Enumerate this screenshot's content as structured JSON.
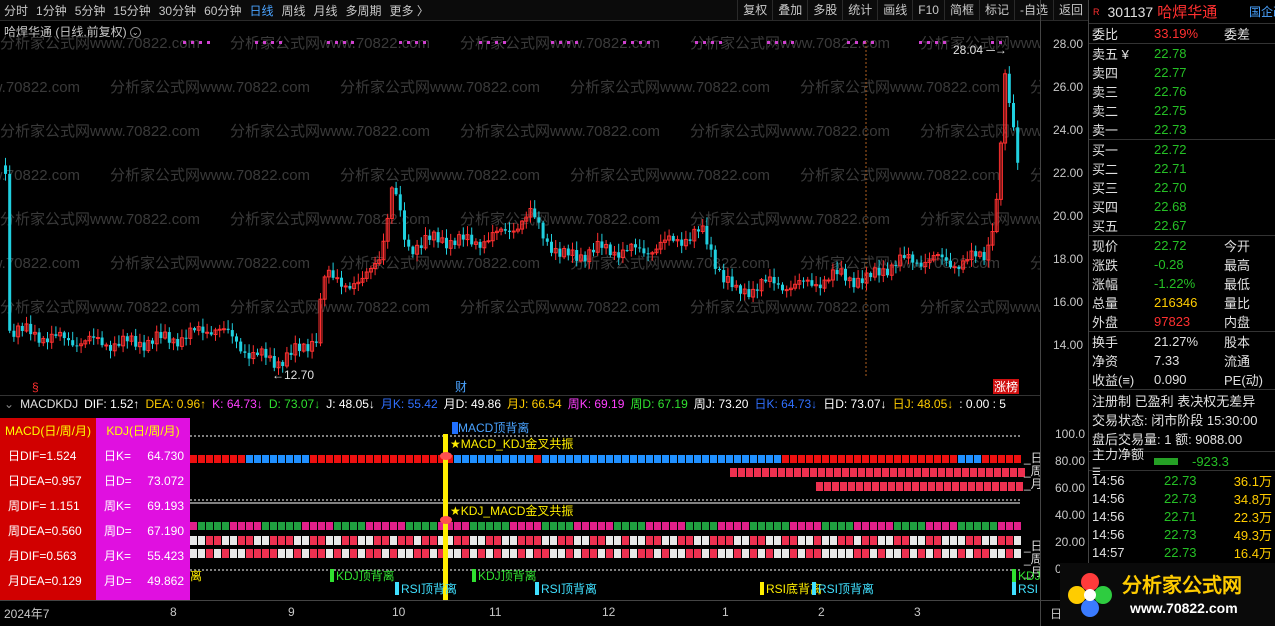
{
  "toolbar": {
    "tabs": [
      "分时",
      "1分钟",
      "5分钟",
      "15分钟",
      "30分钟",
      "60分钟",
      "日线",
      "周线",
      "月线",
      "多周期",
      "更多 〉"
    ],
    "active_tab": "日线",
    "tools": [
      "复权",
      "叠加",
      "多股",
      "统计",
      "画线",
      "F10",
      "简框",
      "标记",
      "-自选",
      "返回"
    ]
  },
  "chart": {
    "title": "哈焊华通 (日线,前复权)",
    "watermark": "分析家公式网www.70822.com",
    "high_label": "28.04",
    "low_label": "12.70",
    "flag_s": "§",
    "flag_cai": "财",
    "flag_zhangbang": "涨榜",
    "yticks": [
      "28.00",
      "26.00",
      "24.00",
      "22.00",
      "20.00",
      "18.00",
      "16.00",
      "14.00"
    ]
  },
  "indicator_bar": {
    "name": "MACDKDJ",
    "items": [
      {
        "text": "DIF: 1.52↑",
        "color": "#ffffff"
      },
      {
        "text": "DEA: 0.96↑",
        "color": "#ffcc00"
      },
      {
        "text": "K: 64.73↓",
        "color": "#ff40ff"
      },
      {
        "text": "D: 73.07↓",
        "color": "#30e030"
      },
      {
        "text": "J: 48.05↓",
        "color": "#ffffff"
      },
      {
        "text": "月K: 55.42",
        "color": "#3070ff"
      },
      {
        "text": "月D: 49.86",
        "color": "#ffffff"
      },
      {
        "text": "月J: 66.54",
        "color": "#ffcc00"
      },
      {
        "text": "周K: 69.19",
        "color": "#ff40ff"
      },
      {
        "text": "周D: 67.19",
        "color": "#30e030"
      },
      {
        "text": "周J: 73.20",
        "color": "#ffffff"
      },
      {
        "text": "日K: 64.73↓",
        "color": "#3070ff"
      },
      {
        "text": "日D: 73.07↓",
        "color": "#ffffff"
      },
      {
        "text": "日J: 48.05↓",
        "color": "#ffcc00"
      },
      {
        "text": ": 0.00 : 5",
        "color": "#ffffff"
      }
    ]
  },
  "ind_panel": {
    "head_left": "MACD(日/周/月)",
    "head_right": "KDJ(日/周/月)",
    "left": [
      "日DIF=1.524",
      "日DEA=0.957",
      "周DIF= 1.151",
      "周DEA=0.560",
      "月DIF=0.563",
      "月DEA=0.129"
    ],
    "right_labels": [
      "日K=",
      "日D=",
      "周K=",
      "周D=",
      "月K=",
      "月D="
    ],
    "right_values": [
      "64.730",
      "73.072",
      "69.193",
      "67.190",
      "55.423",
      "49.862"
    ]
  },
  "lower": {
    "yticks": [
      "100.0",
      "80.00",
      "60.00",
      "40.00",
      "20.00",
      "0.00"
    ],
    "signal1": "★MACD_KDJ金叉共振",
    "signal2": "★KDJ_MACD金叉共振",
    "top_label": "MACD顶背离",
    "row_labels": [
      "日",
      "周",
      "月"
    ],
    "bottom_labels": [
      "离",
      "KDJ顶背离",
      "RSI顶背离",
      "KDJ顶背离",
      "RSI顶背离",
      "RSI底背离",
      "RSI顶背离",
      "KDJ",
      "RSI"
    ]
  },
  "xaxis": {
    "labels": [
      "2024年7",
      "8",
      "9",
      "10",
      "11",
      "12",
      "1",
      "2",
      "3",
      "日"
    ]
  },
  "right_panel": {
    "code": "301137",
    "name": "哈焊华通",
    "tag": "国企改",
    "r": "R",
    "weibi_label": "委比",
    "weibi_val": "33.19%",
    "weicha": "委差",
    "asks": [
      {
        "l": "卖五 ¥",
        "v": "22.78"
      },
      {
        "l": "卖四",
        "v": "22.77"
      },
      {
        "l": "卖三",
        "v": "22.76"
      },
      {
        "l": "卖二",
        "v": "22.75"
      },
      {
        "l": "卖一",
        "v": "22.73"
      }
    ],
    "bids": [
      {
        "l": "买一",
        "v": "22.72"
      },
      {
        "l": "买二",
        "v": "22.71"
      },
      {
        "l": "买三",
        "v": "22.70"
      },
      {
        "l": "买四",
        "v": "22.68"
      },
      {
        "l": "买五",
        "v": "22.67"
      }
    ],
    "stats": [
      {
        "l": "现价",
        "v": "22.72",
        "x": "今开",
        "c": "#25c025"
      },
      {
        "l": "涨跌",
        "v": "-0.28",
        "x": "最高",
        "c": "#25c025"
      },
      {
        "l": "涨幅",
        "v": "-1.22%",
        "x": "最低",
        "c": "#25c025"
      },
      {
        "l": "总量",
        "v": "216346",
        "x": "量比",
        "c": "#ffcc00"
      },
      {
        "l": "外盘",
        "v": "97823",
        "x": "内盘",
        "c": "#ff3030"
      }
    ],
    "stats2": [
      {
        "l": "换手",
        "v": "21.27%",
        "x": "股本"
      },
      {
        "l": "净资",
        "v": "7.33",
        "x": "流通"
      },
      {
        "l": "收益(≡)",
        "v": "0.090",
        "x": "PE(动)"
      }
    ],
    "info": [
      "注册制 已盈利 表决权无差异",
      "交易状态: 闭市阶段 15:30:00",
      "盘后交易量: 1 额: 9088.00"
    ],
    "net_label": "主力净额",
    "net_val": "-923.3",
    "trades": [
      {
        "t": "14:56",
        "p": "22.73",
        "v": "36.1万"
      },
      {
        "t": "14:56",
        "p": "22.73",
        "v": "34.8万"
      },
      {
        "t": "14:56",
        "p": "22.71",
        "v": "22.3万"
      },
      {
        "t": "14:56",
        "p": "22.73",
        "v": "49.3万"
      },
      {
        "t": "14:57",
        "p": "22.73",
        "v": "16.4万"
      }
    ]
  },
  "logo": {
    "text": "分析家公式网",
    "url": "www.70822.com"
  }
}
